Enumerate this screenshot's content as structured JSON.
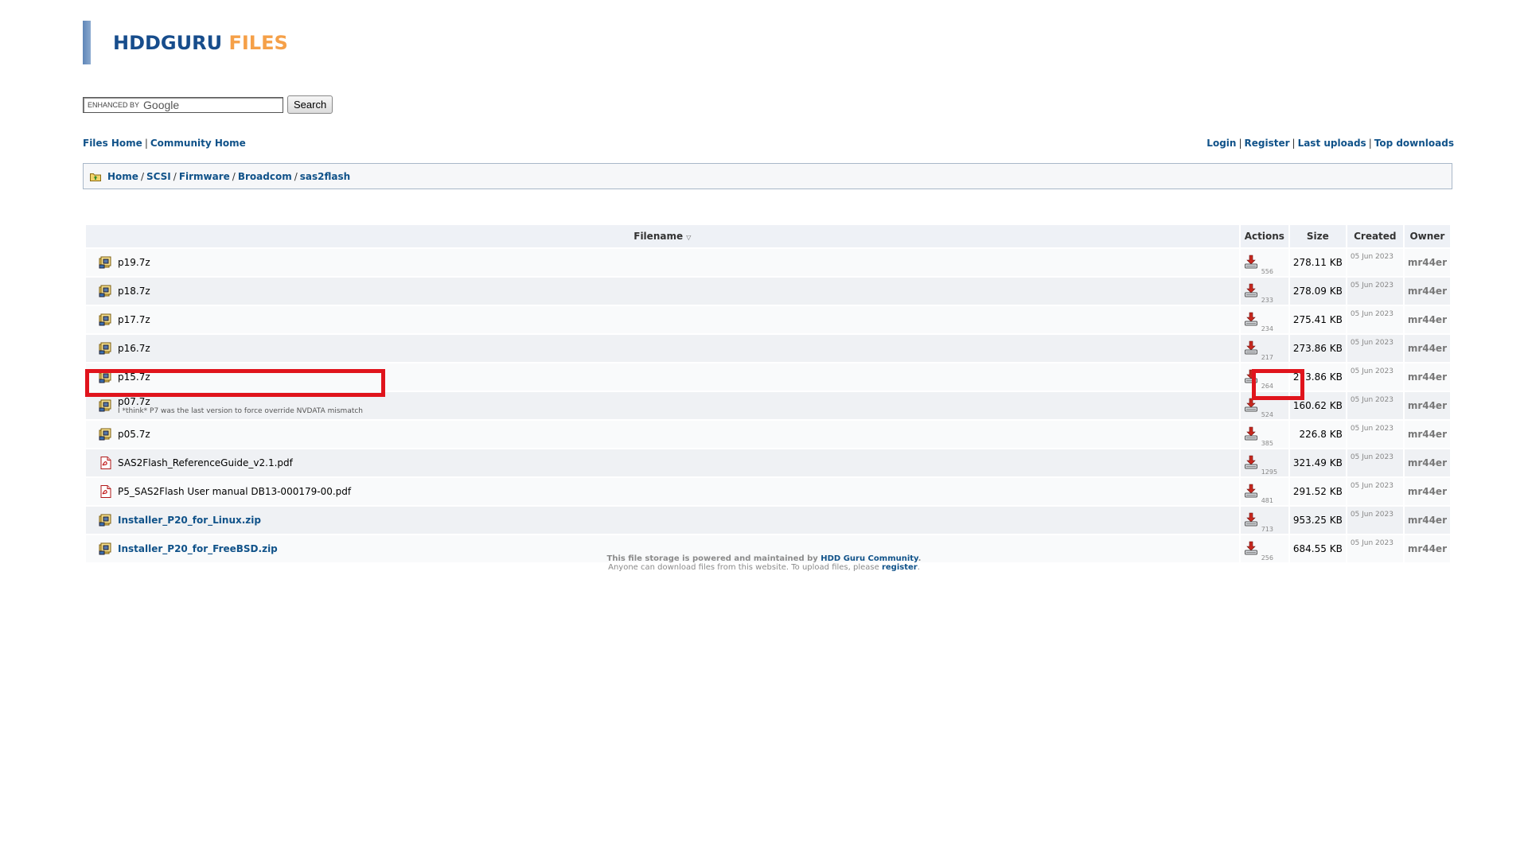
{
  "logo": {
    "part1": "HDDGURU",
    "part2": "FILES"
  },
  "search": {
    "enhanced_by": "ENHANCED BY",
    "google": "Google",
    "button": "Search"
  },
  "nav_left": [
    "Files Home",
    "Community Home"
  ],
  "nav_right": [
    "Login",
    "Register",
    "Last uploads",
    "Top downloads"
  ],
  "breadcrumb": [
    "Home",
    "SCSI",
    "Firmware",
    "Broadcom",
    "sas2flash"
  ],
  "table": {
    "headers": {
      "filename": "Filename",
      "actions": "Actions",
      "size": "Size",
      "created": "Created",
      "owner": "Owner"
    },
    "rows": [
      {
        "name": "p19.7z",
        "type": "archive",
        "downloads": "556",
        "size": "278.11 KB",
        "created": "05 Jun 2023",
        "owner": "mr44er"
      },
      {
        "name": "p18.7z",
        "type": "archive",
        "downloads": "233",
        "size": "278.09 KB",
        "created": "05 Jun 2023",
        "owner": "mr44er"
      },
      {
        "name": "p17.7z",
        "type": "archive",
        "downloads": "234",
        "size": "275.41 KB",
        "created": "05 Jun 2023",
        "owner": "mr44er"
      },
      {
        "name": "p16.7z",
        "type": "archive",
        "downloads": "217",
        "size": "273.86 KB",
        "created": "05 Jun 2023",
        "owner": "mr44er"
      },
      {
        "name": "p15.7z",
        "type": "archive",
        "downloads": "264",
        "size": "273.86 KB",
        "created": "05 Jun 2023",
        "owner": "mr44er"
      },
      {
        "name": "p07.7z",
        "type": "archive",
        "description": "I *think* P7 was the last version to force override NVDATA mismatch",
        "downloads": "524",
        "size": "160.62 KB",
        "created": "05 Jun 2023",
        "owner": "mr44er"
      },
      {
        "name": "p05.7z",
        "type": "archive",
        "downloads": "385",
        "size": "226.8 KB",
        "created": "05 Jun 2023",
        "owner": "mr44er"
      },
      {
        "name": "SAS2Flash_ReferenceGuide_v2.1.pdf",
        "type": "pdf",
        "downloads": "1295",
        "size": "321.49 KB",
        "created": "05 Jun 2023",
        "owner": "mr44er"
      },
      {
        "name": "P5_SAS2Flash User manual DB13-000179-00.pdf",
        "type": "pdf",
        "downloads": "481",
        "size": "291.52 KB",
        "created": "05 Jun 2023",
        "owner": "mr44er"
      },
      {
        "name": "Installer_P20_for_Linux.zip",
        "type": "archive",
        "bold": true,
        "downloads": "713",
        "size": "953.25 KB",
        "created": "05 Jun 2023",
        "owner": "mr44er"
      },
      {
        "name": "Installer_P20_for_FreeBSD.zip",
        "type": "archive",
        "bold": true,
        "downloads": "256",
        "size": "684.55 KB",
        "created": "05 Jun 2023",
        "owner": "mr44er"
      }
    ]
  },
  "footer": {
    "line1_prefix": "This file storage is powered and maintained by ",
    "line1_link": "HDD Guru Community",
    "line1_suffix": ".",
    "line2_prefix": "Anyone can download files from this website. To upload files, please ",
    "line2_link": "register",
    "line2_suffix": "."
  },
  "colors": {
    "link": "#105289",
    "logo_blue": "#174d8c",
    "logo_orange": "#f5a048",
    "highlight": "#e0141c"
  }
}
